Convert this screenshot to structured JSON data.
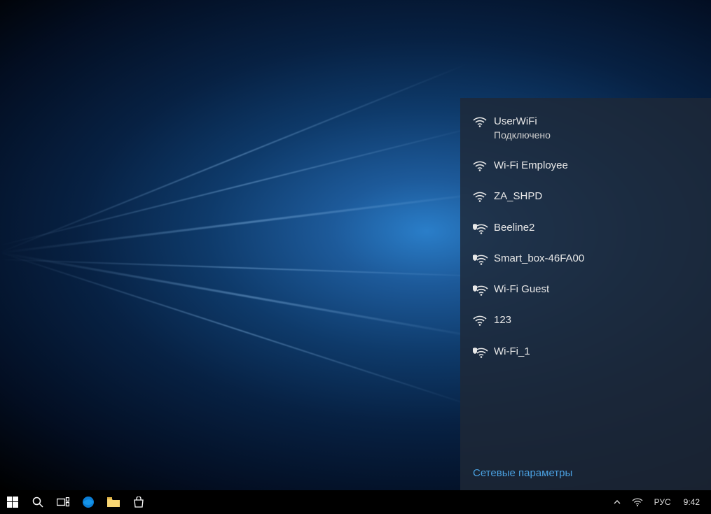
{
  "wifi": {
    "networks": [
      {
        "name": "UserWiFi",
        "status": "Подключено",
        "secured": false
      },
      {
        "name": "Wi-Fi Employee",
        "status": "",
        "secured": false
      },
      {
        "name": "ZA_SHPD",
        "status": "",
        "secured": false
      },
      {
        "name": "Beeline2",
        "status": "",
        "secured": true
      },
      {
        "name": "Smart_box-46FA00",
        "status": "",
        "secured": true
      },
      {
        "name": "Wi-Fi Guest",
        "status": "",
        "secured": true
      },
      {
        "name": "123",
        "status": "",
        "secured": false
      },
      {
        "name": "Wi-Fi_1",
        "status": "",
        "secured": true
      }
    ],
    "settings_link": "Сетевые параметры"
  },
  "taskbar": {
    "lang": "РУС",
    "clock": "9:42"
  }
}
